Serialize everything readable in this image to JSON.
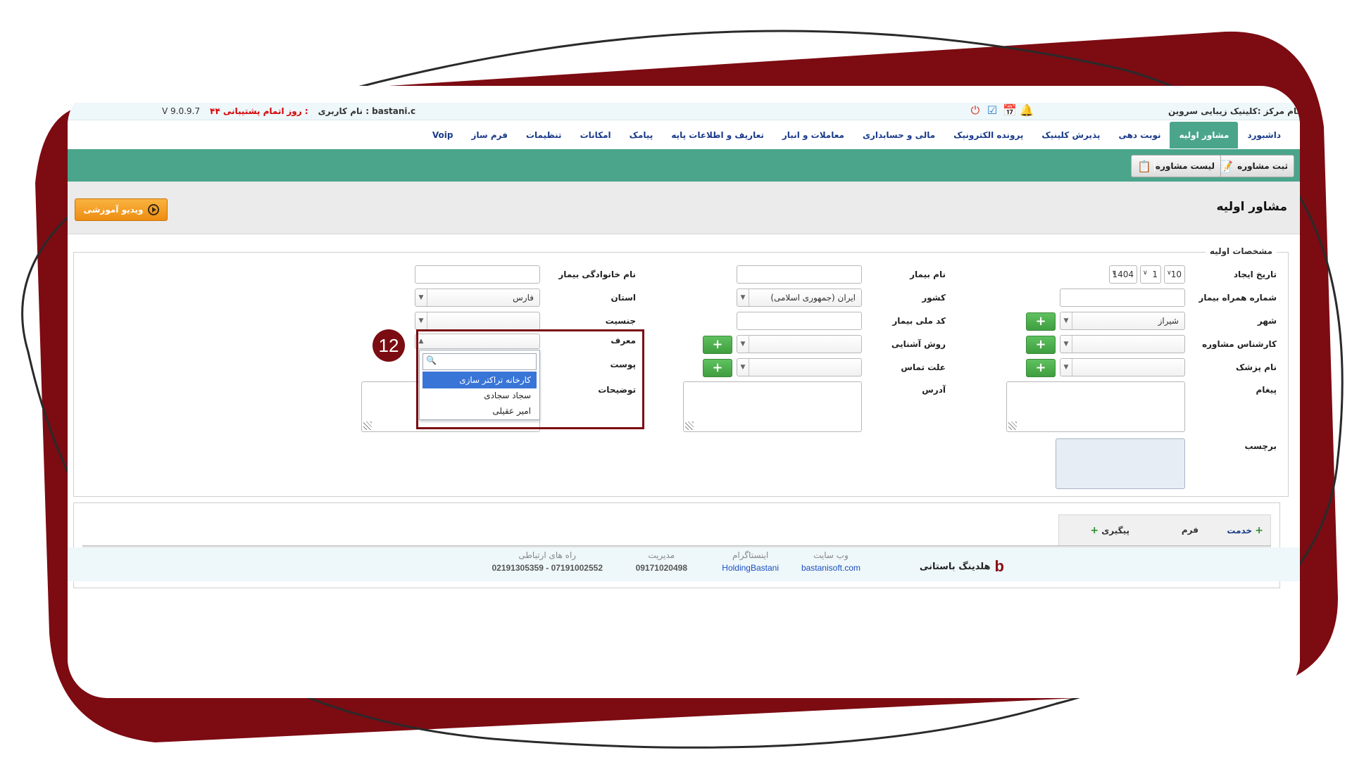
{
  "topbar": {
    "center_name": "نام مرکز :کلینیک زیبایی سروین",
    "version": "V 9.0.9.7",
    "support_label": "اتمام پشتیبانی :",
    "support_days": "۴۴ روز",
    "username": "نام کاربری : bastani.c"
  },
  "icons": {
    "power": "power-icon",
    "calendar_check": "calendar-check-icon",
    "calendar": "calendar-icon",
    "bell": "bell-icon"
  },
  "menu": [
    "داشبورد",
    "مشاور اولیه",
    "نوبت دهی",
    "پذیرش کلینیک",
    "پرونده الکترونیک",
    "مالی و حسابداری",
    "معاملات و انبار",
    "تعاریف و اطلاعات پایه",
    "پیامک",
    "امکانات",
    "تنظیمات",
    "فرم ساز",
    "Voip"
  ],
  "toolbar": {
    "register": "ثبت مشاوره",
    "list": "لیست مشاوره"
  },
  "page": {
    "title": "مشاور اولیه",
    "video_button": "ویدیو آموزشی",
    "legend": "مشخصات اولیه"
  },
  "form": {
    "created_date_label": "تاریخ ایجاد",
    "date": {
      "day": "10",
      "month": "1",
      "year": "1404"
    },
    "patient_name_label": "نام بیمار",
    "patient_family_label": "نام خانوادگی بیمار",
    "companion_phone_label": "شماره همراه بیمار",
    "country_label": "کشور",
    "country_value": "ایران (جمهوری اسلامی)",
    "province_label": "استان",
    "province_value": "فارس",
    "city_label": "شهر",
    "city_value": "شیراز",
    "national_code_label": "کد ملی بیمار",
    "gender_label": "جنسیت",
    "consultant_label": "کارشناس مشاوره",
    "acquaintance_label": "روش آشنایی",
    "referrer_label": "معرف",
    "doctor_label": "نام پزشک",
    "contact_reason_label": "علت تماس",
    "skin_label": "پوست",
    "message_label": "پیغام",
    "address_label": "آدرس",
    "notes_label": "توضیحات",
    "tag_label": "برچسب",
    "plus": "+"
  },
  "referrer_dropdown": {
    "search_value": "",
    "options": [
      "کارخانه تراکتر سازی",
      "سجاد سجادی",
      "امیر عقیلی"
    ],
    "selected_index": 0
  },
  "step_badge": "12",
  "tabs": {
    "service": "خدمت",
    "form": "فرم",
    "followup": "پیگیری"
  },
  "footer": {
    "brand": "هلدینگ باستانی",
    "website_cap": "وب سایت",
    "website": "bastanisoft.com",
    "instagram_cap": "اینستاگرام",
    "instagram": "HoldingBastani",
    "manager_cap": "مدیریت",
    "manager": "09171020498",
    "contacts_cap": "راه های ارتباطی",
    "contacts": "07191002552 - 02191305359"
  },
  "colors": {
    "accent_green": "#4aa58b",
    "frame_red": "#7a0c12",
    "menu_text": "#1a3a8a"
  }
}
